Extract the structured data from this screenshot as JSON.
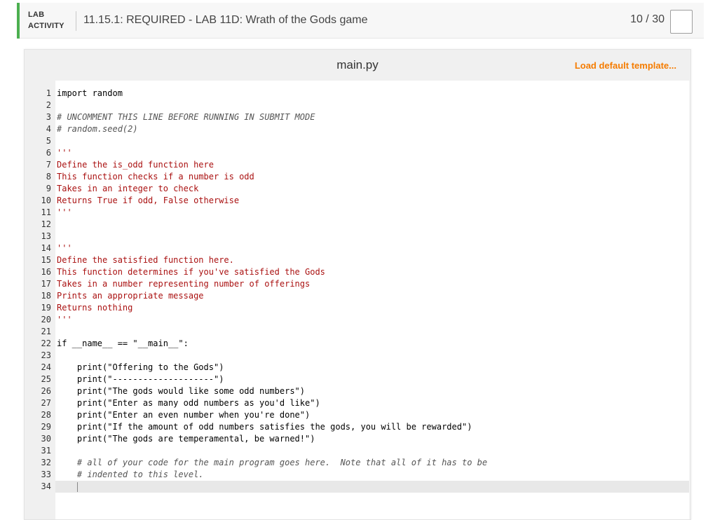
{
  "header": {
    "lab_label": "LAB",
    "activity_label": "ACTIVITY",
    "title": "11.15.1: REQUIRED - LAB 11D: Wrath of the Gods game",
    "score": "10 / 30"
  },
  "editor": {
    "file_name": "main.py",
    "load_template": "Load default template...",
    "active_line": 34,
    "lines": [
      "import random",
      "",
      "# UNCOMMENT THIS LINE BEFORE RUNNING IN SUBMIT MODE",
      "# random.seed(2)",
      "",
      "'''",
      "Define the is_odd function here",
      "This function checks if a number is odd",
      "Takes in an integer to check",
      "Returns True if odd, False otherwise",
      "'''",
      "",
      "",
      "'''",
      "Define the satisfied function here.",
      "This function determines if you've satisfied the Gods",
      "Takes in a number representing number of offerings",
      "Prints an appropriate message",
      "Returns nothing",
      "'''",
      "",
      "if __name__ == \"__main__\":",
      "",
      "    print(\"Offering to the Gods\")",
      "    print(\"--------------------\")",
      "    print(\"The gods would like some odd numbers\")",
      "    print(\"Enter as many odd numbers as you'd like\")",
      "    print(\"Enter an even number when you're done\")",
      "    print(\"If the amount of odd numbers satisfies the gods, you will be rewarded\")",
      "    print(\"The gods are temperamental, be warned!\")",
      "",
      "    # all of your code for the main program goes here.  Note that all of it has to be",
      "    # indented to this level.",
      "    "
    ]
  },
  "colors": {
    "accent": "#4caf50",
    "link": "#f57c00"
  }
}
